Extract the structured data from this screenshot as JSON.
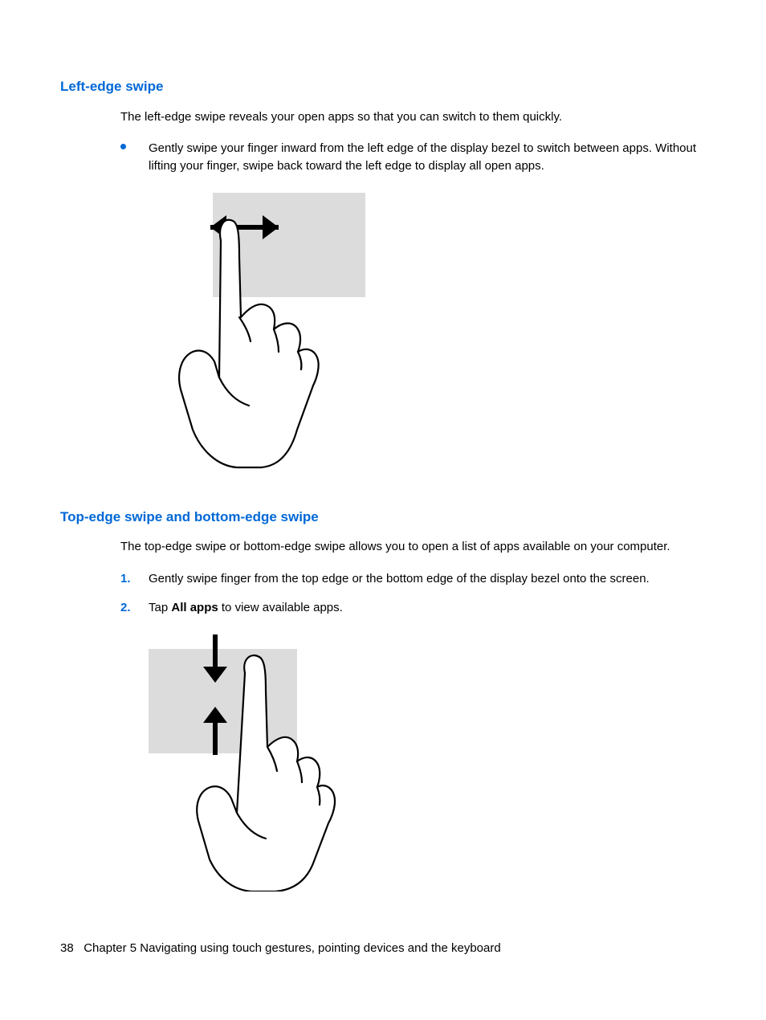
{
  "section1": {
    "heading": "Left-edge swipe",
    "intro": "The left-edge swipe reveals your open apps so that you can switch to them quickly.",
    "bullet": "Gently swipe your finger inward from the left edge of the display bezel to switch between apps. Without lifting your finger, swipe back toward the left edge to display all open apps."
  },
  "section2": {
    "heading": "Top-edge swipe and bottom-edge swipe",
    "intro": "The top-edge swipe or bottom-edge swipe allows you to open a list of apps available on your computer.",
    "step1": "Gently swipe finger from the top edge or the bottom edge of the display bezel onto the screen.",
    "step2_prefix": "Tap ",
    "step2_bold": "All apps",
    "step2_suffix": " to view available apps.",
    "marker1": "1.",
    "marker2": "2."
  },
  "footer": {
    "page": "38",
    "chapter": "Chapter 5   Navigating using touch gestures, pointing devices and the keyboard"
  }
}
